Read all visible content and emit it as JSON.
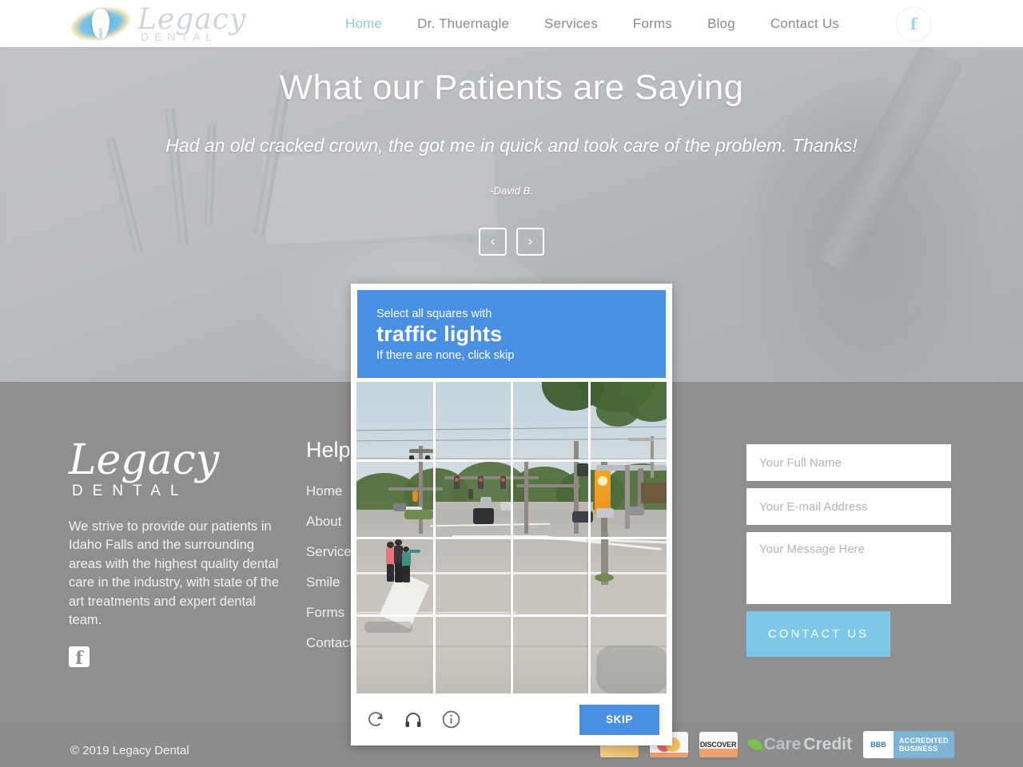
{
  "header": {
    "logo": {
      "script": "Legacy",
      "sub": "DENTAL",
      "icon": "tooth-logo-icon"
    },
    "nav": [
      {
        "label": "Home",
        "active": true
      },
      {
        "label": "Dr. Thuernagle",
        "active": false
      },
      {
        "label": "Services",
        "active": false
      },
      {
        "label": "Forms",
        "active": false
      },
      {
        "label": "Blog",
        "active": false
      },
      {
        "label": "Contact Us",
        "active": false
      }
    ],
    "facebook_glyph": "f"
  },
  "hero": {
    "title": "What our Patients are Saying",
    "quote": "Had an old cracked crown, the got me in quick and took care of the problem. Thanks!",
    "author": "-David B.",
    "prev_glyph": "‹",
    "next_glyph": "›"
  },
  "footer": {
    "logo": {
      "script": "Legacy",
      "sub": "DENTAL"
    },
    "about": "We strive to provide our patients in Idaho Falls and the surrounding areas with the highest quality dental care in the industry, with state of the art treatments and expert dental team.",
    "facebook_glyph": "f",
    "links_heading": "Helpful",
    "links": [
      {
        "label": "Home"
      },
      {
        "label": "About"
      },
      {
        "label": "Services"
      },
      {
        "label": "Smile"
      },
      {
        "label": "Forms"
      },
      {
        "label": "Contact"
      }
    ],
    "form": {
      "name_placeholder": "Your Full Name",
      "name_value": "",
      "email_placeholder": "Your E-mail Address",
      "email_value": "",
      "message_placeholder": "Your Message Here",
      "message_value": "",
      "submit_label": "CONTACT US"
    }
  },
  "bottombar": {
    "copyright": "© 2019 Legacy Dental",
    "badges": [
      {
        "name": "visa-card-badge",
        "label": "VISA"
      },
      {
        "name": "mastercard-badge",
        "label": "MasterCard"
      },
      {
        "name": "discover-badge",
        "label": "DISCOVER"
      },
      {
        "name": "carecredit-badge",
        "label_a": "Care",
        "label_b": "Credit"
      },
      {
        "name": "bbb-badge",
        "label_a": "BBB",
        "label_b1": "ACCREDITED",
        "label_b2": "BUSINESS"
      }
    ]
  },
  "captcha": {
    "prompt_pre": "Select all squares with",
    "prompt_target": "traffic lights",
    "prompt_post": "If there are none, click skip",
    "skip_label": "SKIP",
    "reload_icon": "reload-icon",
    "audio_icon": "headphones-icon",
    "info_icon": "info-icon",
    "grid": {
      "rows": 4,
      "cols": 4,
      "selected": []
    },
    "accent_color": "#4a90e2"
  },
  "colors": {
    "accent_blue": "#4a90e2",
    "footer_gray": "#8f8f8f",
    "bottombar_gray": "#8c8c8c",
    "brand_light_blue": "#7dc8e8",
    "nav_active": "#8ecbe8"
  }
}
